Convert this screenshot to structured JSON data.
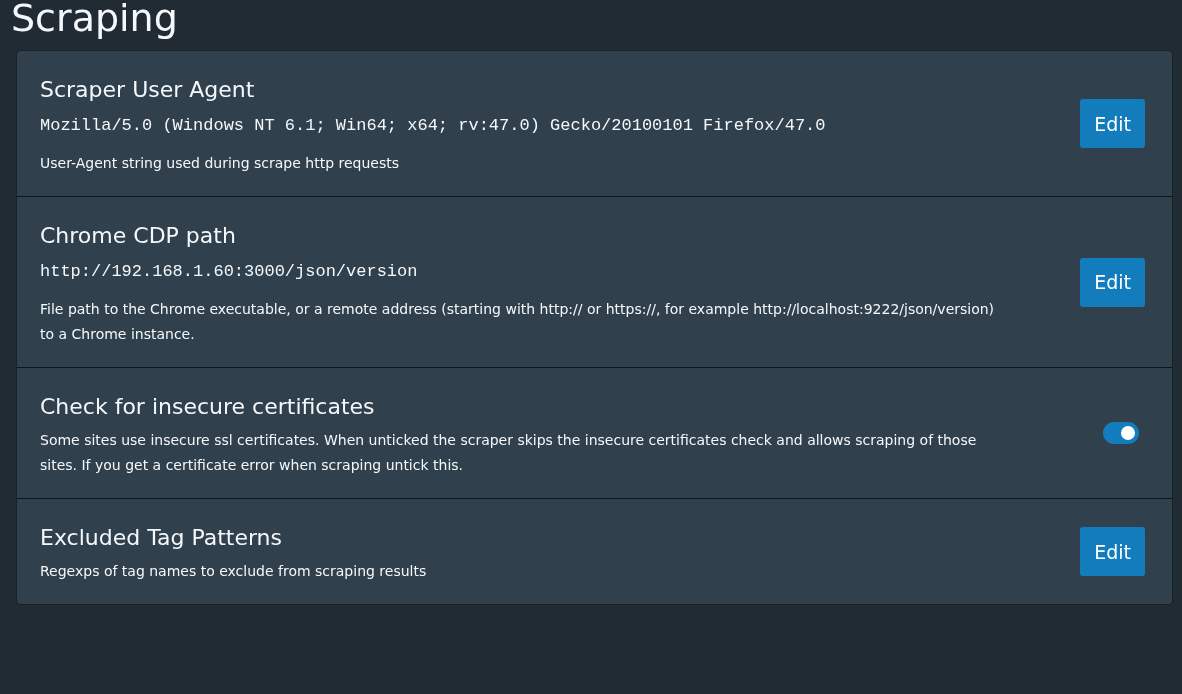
{
  "page_title": "Scraping",
  "settings": [
    {
      "kind": "edit",
      "title": "Scraper User Agent",
      "value": "Mozilla/5.0 (Windows NT 6.1; Win64; x64; rv:47.0) Gecko/20100101 Firefox/47.0",
      "description": "User-Agent string used during scrape http requests",
      "button": "Edit"
    },
    {
      "kind": "edit",
      "title": "Chrome CDP path",
      "value": "http://192.168.1.60:3000/json/version",
      "description": "File path to the Chrome executable, or a remote address (starting with http:// or https://, for example http://localhost:9222/json/version) to a Chrome instance.",
      "button": "Edit"
    },
    {
      "kind": "toggle",
      "title": "Check for insecure certificates",
      "description": "Some sites use insecure ssl certificates. When unticked the scraper skips the insecure certificates check and allows scraping of those sites. If you get a certificate error when scraping untick this.",
      "on": true
    },
    {
      "kind": "edit",
      "title": "Excluded Tag Patterns",
      "description": "Regexps of tag names to exclude from scraping results",
      "button": "Edit"
    }
  ]
}
